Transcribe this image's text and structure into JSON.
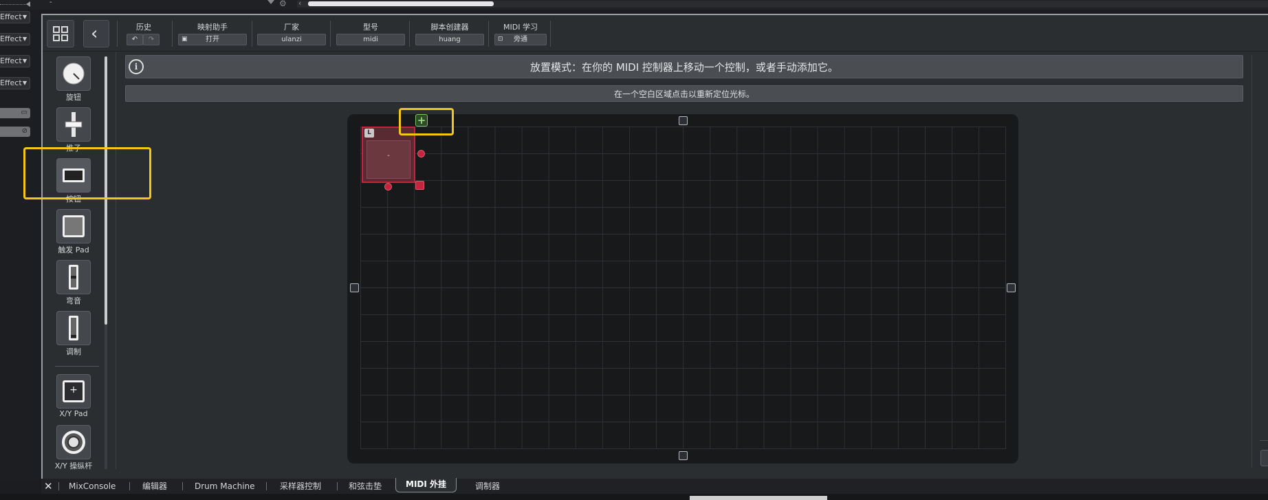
{
  "top_strip": {
    "dash": "-",
    "gear_icon": "gear-icon",
    "chevron": "‹"
  },
  "left_strip": {
    "fx_slots": [
      {
        "label": "Effect",
        "arrow": "▼"
      },
      {
        "label": "Effect",
        "arrow": "▼"
      },
      {
        "label": "Effect",
        "arrow": "▼"
      },
      {
        "label": "Effect",
        "arrow": "▼"
      }
    ]
  },
  "toolbar": {
    "layout_icon": "grid-icon",
    "back_icon": "‹",
    "history": {
      "label": "历史",
      "undo_icon": "↶",
      "redo_icon": "↷"
    },
    "mapping_assistant": {
      "label": "映射助手",
      "value": "打开"
    },
    "vendor": {
      "label": "厂家",
      "value": "ulanzi"
    },
    "model": {
      "label": "型号",
      "value": "midi"
    },
    "script_creator": {
      "label": "脚本创建器",
      "value": "huang"
    },
    "midi_learn": {
      "label": "MIDI 学习",
      "value": "旁通"
    }
  },
  "palette": {
    "items": [
      {
        "label": "旋钮",
        "icon": "knob-icon"
      },
      {
        "label": "推子",
        "icon": "fader-icon"
      },
      {
        "label": "按钮",
        "icon": "button-icon"
      },
      {
        "label": "触发 Pad",
        "icon": "pad-icon"
      },
      {
        "label": "弯音",
        "icon": "pitchbend-icon"
      },
      {
        "label": "调制",
        "icon": "modulation-icon"
      },
      {
        "label": "X/Y Pad",
        "icon": "xy-pad-icon"
      },
      {
        "label": "X/Y 操纵杆",
        "icon": "joystick-icon"
      }
    ],
    "xy_pad_glyph": "+"
  },
  "banner": {
    "info_icon": "i",
    "placement_text": "放置模式：在你的 MIDI 控制器上移动一个控制，或者手动添加它。",
    "hint_text": "在一个空白区域点击以重新定位光标。"
  },
  "canvas": {
    "control": {
      "label": "-",
      "lock_glyph": "L"
    },
    "add_button": "+"
  },
  "bottom_tabs": {
    "close": "✕",
    "tabs": [
      "MixConsole",
      "编辑器",
      "Drum Machine",
      "采样器控制",
      "和弦击垫",
      "MIDI 外挂",
      "调制器"
    ],
    "active": "MIDI 外挂"
  },
  "colors": {
    "accent_highlight": "#f5c518",
    "control_red": "#c4243d",
    "add_green": "#7ac85a",
    "panel_bg": "#2b2e31"
  }
}
